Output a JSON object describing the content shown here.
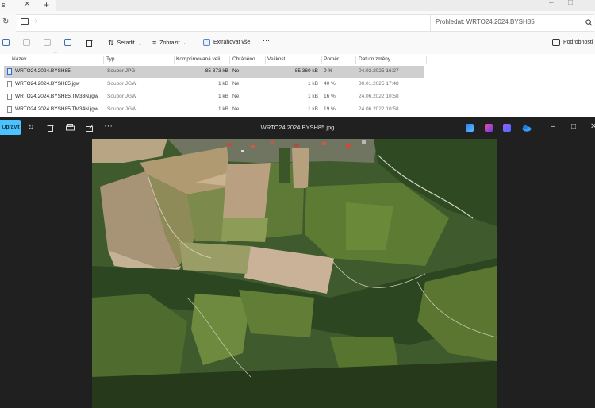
{
  "tabbar": {
    "tab_label": "s",
    "close": "×",
    "new_tab": "+"
  },
  "address": {
    "search_placeholder": "Prohledat: WRTO24.2024.BYSH85"
  },
  "toolbar": {
    "sort_label": "Seřadit",
    "view_label": "Zobrazit",
    "extract_label": "Extrahovat vše",
    "more_label": "···",
    "details_label": "Podrobnosti"
  },
  "columns": [
    "Název",
    "Typ",
    "Komprimovaná veli...",
    "Chráněno ...",
    "Velikost",
    "Poměr",
    "Datum změny"
  ],
  "files": [
    {
      "name": "WRTO24.2024.BYSH85",
      "type": "Soubor JPG",
      "compressed": "85 373 kB",
      "protected": "Ne",
      "size": "85 360 kB",
      "ratio": "0 %",
      "date": "04.02.2025 16:27"
    },
    {
      "name": "WRTO24.2024.BYSH85.jgw",
      "type": "Soubor JGW",
      "compressed": "1 kB",
      "protected": "Ne",
      "size": "1 kB",
      "ratio": "40 %",
      "date": "30.01.2025 17:48"
    },
    {
      "name": "WRTO24.2024.BYSH85.TM33N.jgw",
      "type": "Soubor JGW",
      "compressed": "1 kB",
      "protected": "Ne",
      "size": "1 kB",
      "ratio": "16 %",
      "date": "24.06.2022 10:58"
    },
    {
      "name": "WRTO24.2024.BYSH85.TM34N.jgw",
      "type": "Soubor JGW",
      "compressed": "1 kB",
      "protected": "Ne",
      "size": "1 kB",
      "ratio": "19 %",
      "date": "24.06.2022 10:58"
    }
  ],
  "viewer": {
    "edit_label": "Upravit",
    "title": "WRTO24.2024.BYSH85.jpg",
    "more_label": "···"
  },
  "colors": {
    "accent": "#4cc2ff",
    "viewer_bg": "#202020",
    "selected_row": "#cfcfcf"
  }
}
